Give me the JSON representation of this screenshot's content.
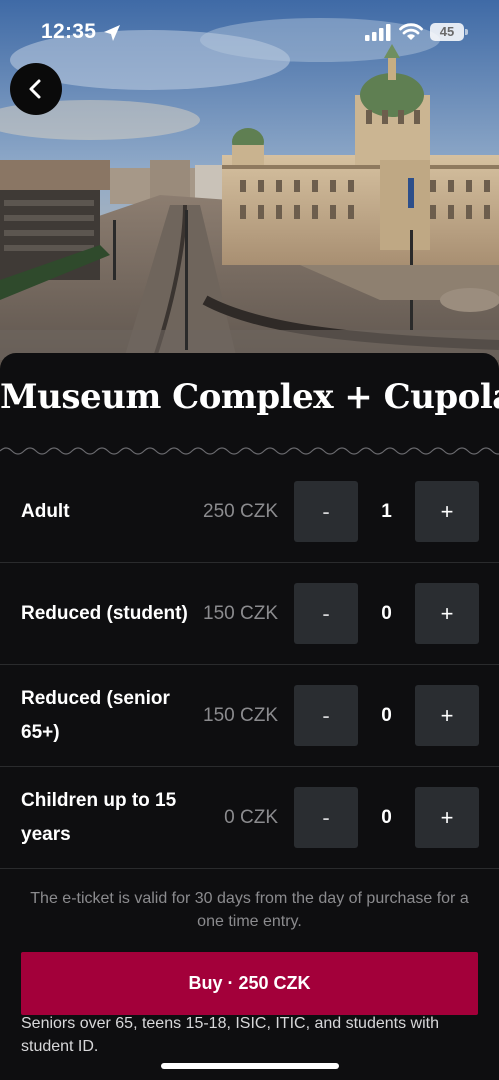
{
  "status_bar": {
    "time": "12:35",
    "battery": "45",
    "location_icon": "location-arrow-icon",
    "signal_icon": "signal-icon",
    "wifi_icon": "wifi-icon"
  },
  "header": {
    "back_icon": "chevron-left-icon"
  },
  "hero": {
    "image_alt": "National Museum building at the top of a city square"
  },
  "ticket": {
    "title": "Museum Complex + Cupola",
    "rows": [
      {
        "label": "Adult",
        "price": "250 CZK",
        "quantity": "1"
      },
      {
        "label": "Reduced (student)",
        "price": "150 CZK",
        "quantity": "0"
      },
      {
        "label": "Reduced (senior 65+)",
        "price": "150 CZK",
        "quantity": "0"
      },
      {
        "label": "Children up to 15 years",
        "price": "0 CZK",
        "quantity": "0"
      }
    ],
    "minus_label": "-",
    "plus_label": "+",
    "validity_text": "The e-ticket is valid for 30 days from the day of purchase for a one time entry.",
    "buy_label": "Buy · 250 CZK",
    "note": "Seniors over 65, teens 15-18, ISIC, ITIC, and students with student ID."
  },
  "colors": {
    "background": "#0e0e10",
    "accent": "#a3003a",
    "stepper": "#2a2d31",
    "muted_text": "#8b8b8e"
  }
}
